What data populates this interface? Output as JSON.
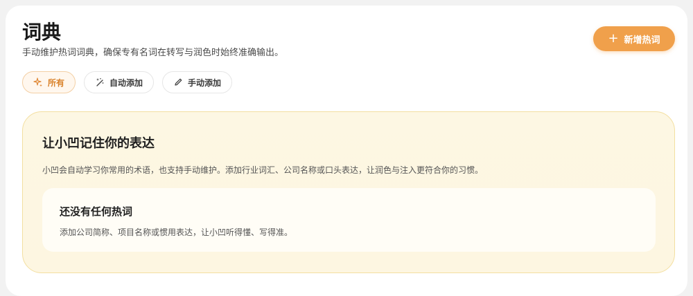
{
  "header": {
    "title": "词典",
    "subtitle": "手动维护热词词典，确保专有名词在转写与润色时始终准确输出。",
    "add_button_label": "新增热词"
  },
  "filters": [
    {
      "label": "所有",
      "icon": "sparkle-icon",
      "active": true
    },
    {
      "label": "自动添加",
      "icon": "magic-wand-icon",
      "active": false
    },
    {
      "label": "手动添加",
      "icon": "pencil-icon",
      "active": false
    }
  ],
  "intro": {
    "title": "让小凹记住你的表达",
    "description": "小凹会自动学习你常用的术语，也支持手动维护。添加行业词汇、公司名称或口头表达，让润色与注入更符合你的习惯。"
  },
  "empty_state": {
    "title": "还没有任何热词",
    "description": "添加公司简称、项目名称或惯用表达，让小凹听得懂、写得准。"
  },
  "colors": {
    "accent": "#f0a04b",
    "panel_bg": "#fdf7e3",
    "panel_border": "#f3dfa0"
  }
}
